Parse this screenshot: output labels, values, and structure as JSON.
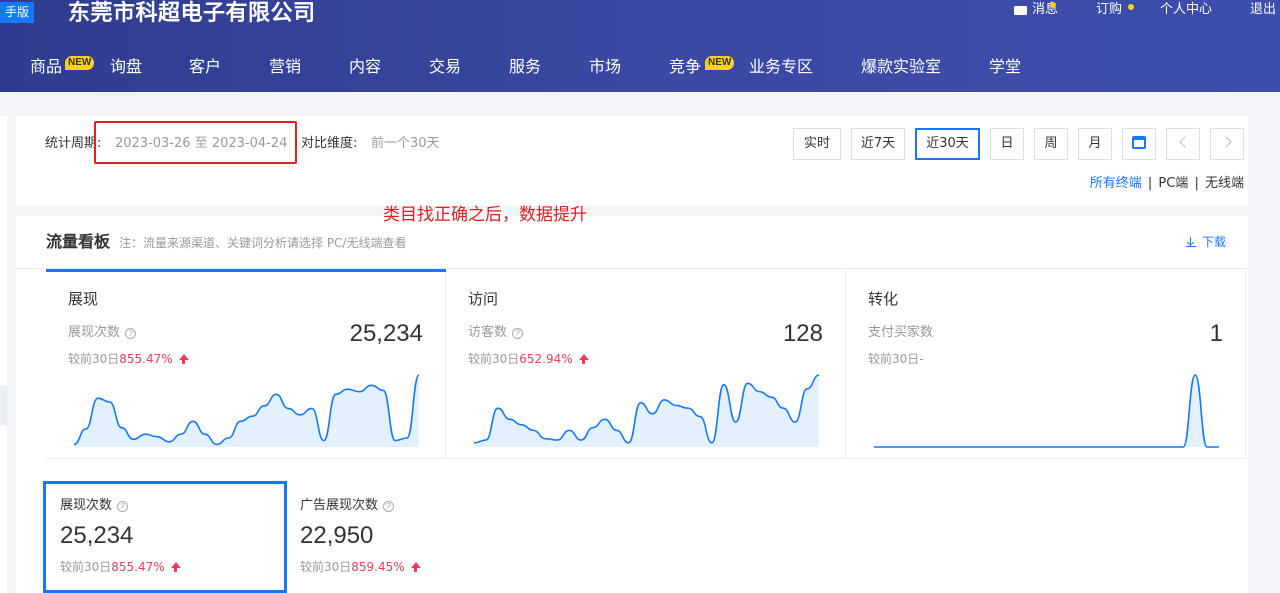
{
  "header": {
    "badge": "手版",
    "company": "东莞市科超电子有限公司",
    "links": {
      "messages": "消息",
      "orders": "订购",
      "profile": "个人中心",
      "logout": "退出"
    },
    "nav": [
      {
        "label": "商品",
        "badge": "NEW"
      },
      {
        "label": "询盘"
      },
      {
        "label": "客户"
      },
      {
        "label": "营销"
      },
      {
        "label": "内容"
      },
      {
        "label": "交易"
      },
      {
        "label": "服务"
      },
      {
        "label": "市场"
      },
      {
        "label": "竞争",
        "badge": "NEW"
      },
      {
        "label": "业务专区"
      },
      {
        "label": "爆款实验室"
      },
      {
        "label": "学堂"
      }
    ]
  },
  "filter": {
    "period_label": "统计周期:",
    "period_value": "2023-03-26 至 2023-04-24",
    "compare_label": "对比维度:",
    "compare_value": "前一个30天",
    "buttons": [
      "实时",
      "近7天",
      "近30天",
      "日",
      "周",
      "月"
    ],
    "selected_button": "近30天",
    "terminals": {
      "all": "所有终端",
      "pc": "PC端",
      "wireless": "无线端",
      "sep": "|"
    }
  },
  "annotation": "类目找正确之后，数据提升",
  "traffic": {
    "title": "流量看板",
    "note": "注：流量来源渠道、关键词分析请选择 PC/无线端查看",
    "download": "下载",
    "panels": [
      {
        "title": "展现",
        "metric": "展现次数",
        "value": "25,234",
        "compare_prefix": "较前30日",
        "compare_pct": "855.47%",
        "series": [
          2,
          14,
          38,
          35,
          15,
          6,
          10,
          8,
          4,
          10,
          20,
          10,
          2,
          7,
          20,
          24,
          32,
          41,
          30,
          25,
          30,
          5,
          41,
          45,
          43,
          48,
          44,
          5,
          7,
          56
        ]
      },
      {
        "title": "访问",
        "metric": "访客数",
        "value": "128",
        "compare_prefix": "较前30日",
        "compare_pct": "652.94%",
        "series": [
          3,
          5,
          28,
          20,
          16,
          12,
          6,
          5,
          12,
          5,
          14,
          20,
          12,
          3,
          32,
          24,
          34,
          30,
          28,
          22,
          3,
          45,
          18,
          46,
          40,
          36,
          28,
          18,
          42,
          52
        ]
      },
      {
        "title": "转化",
        "metric": "支付买家数",
        "value": "1",
        "compare_prefix": "较前30日",
        "compare_pct": "-",
        "series": [
          0,
          0,
          0,
          0,
          0,
          0,
          0,
          0,
          0,
          0,
          0,
          0,
          0,
          0,
          0,
          0,
          0,
          0,
          0,
          0,
          0,
          0,
          0,
          0,
          0,
          0,
          0,
          1,
          0,
          0
        ]
      }
    ],
    "tiles": [
      {
        "label": "展现次数",
        "value": "25,234",
        "compare_prefix": "较前30日",
        "compare_pct": "855.47%"
      },
      {
        "label": "广告展现次数",
        "value": "22,950",
        "compare_prefix": "较前30日",
        "compare_pct": "859.45%"
      }
    ]
  },
  "colors": {
    "accent": "#1677ff",
    "header": "#3a4aa3",
    "up": "#f03c5a",
    "annotation": "#e02020"
  }
}
